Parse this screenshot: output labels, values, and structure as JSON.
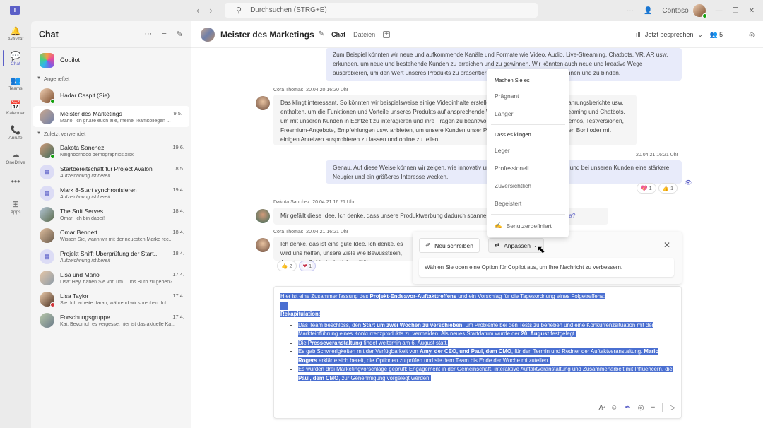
{
  "titlebar": {
    "search_placeholder": "Durchsuchen (STRG+E)",
    "org": "Contoso",
    "icons": [
      "more-icon",
      "people-icon",
      "minimize-icon",
      "restore-icon",
      "close-icon"
    ]
  },
  "rail": [
    {
      "label": "Aktivität",
      "icon": "bell-icon",
      "glyph": "🔔"
    },
    {
      "label": "Chat",
      "icon": "chat-icon",
      "glyph": "💬",
      "active": true
    },
    {
      "label": "Teams",
      "icon": "teams-icon",
      "glyph": "👥"
    },
    {
      "label": "Kalender",
      "icon": "calendar-icon",
      "glyph": "📅"
    },
    {
      "label": "Anrufe",
      "icon": "phone-icon",
      "glyph": "📞"
    },
    {
      "label": "OneDrive",
      "icon": "cloud-icon",
      "glyph": "☁"
    },
    {
      "label": "",
      "icon": "more-icon",
      "glyph": "•••"
    },
    {
      "label": "Apps",
      "icon": "apps-icon",
      "glyph": "⊞"
    }
  ],
  "chatlist": {
    "title": "Chat",
    "copilot": "Copilot",
    "pinned_label": "Angeheftet",
    "recent_label": "Zuletzt verwendet",
    "pinned": [
      {
        "name": "Hadar Caspit (Sie)",
        "preview": "",
        "date": ""
      },
      {
        "name": "Meister des Marketings",
        "preview": "Mario: Ich grüße euch alle, meine Teamkollegen ...",
        "date": "9.5."
      }
    ],
    "recent": [
      {
        "name": "Dakota Sanchez",
        "preview": "Neighborhood demographics.xlsx",
        "date": "19.6.",
        "italic": false
      },
      {
        "name": "Startbereitschaft für Project Avalon",
        "preview": "Aufzeichnung ist bereit",
        "date": "8.5.",
        "italic": true
      },
      {
        "name": "Mark 8-Start synchronisieren",
        "preview": "Aufzeichnung ist bereit",
        "date": "19.4.",
        "italic": true
      },
      {
        "name": "The Soft Serves",
        "preview": "Omar: Ich bin dabei!",
        "date": "18.4.",
        "italic": false
      },
      {
        "name": "Omar Bennett",
        "preview": "Wissen Sie, wann wir mit der neuesten Marke rec...",
        "date": "18.4.",
        "italic": false
      },
      {
        "name": "Projekt Sniff: Überprüfung der Start...",
        "preview": "Aufzeichnung ist bereit",
        "date": "18.4.",
        "italic": true
      },
      {
        "name": "Lisa und Mario",
        "preview": "Lisa: Hey, haben Sie vor, um ... ins Büro zu gehen?",
        "date": "17.4.",
        "italic": false
      },
      {
        "name": "Lisa Taylor",
        "preview": "Sie: Ich arbeite daran, während wir sprechen. Ich...",
        "date": "17.4.",
        "italic": false
      },
      {
        "name": "Forschungsgruppe",
        "preview": "Kai: Bevor ich es vergesse, hier ist das aktuelle Ka...",
        "date": "17.4.",
        "italic": false
      }
    ]
  },
  "header": {
    "title": "Meister des Marketings",
    "tabs": [
      "Chat",
      "Dateien"
    ],
    "meet_now": "Jetzt besprechen",
    "participants": "5"
  },
  "messages": [
    {
      "id": "m1",
      "text": "Zum Beispiel könnten wir neue und aufkommende Kanäle und Formate wie Video, Audio, Live-Streaming, Chatbots, VR, AR usw. erkunden, um neue und bestehende Kunden zu erreichen und zu gewinnen. Wir könnten auch neue und kreative Wege ausprobieren, um den Wert unseres Produkts zu präsentieren und unsere Kunden zu gewinnen und zu binden."
    },
    {
      "id": "m2",
      "author": "Cora Thomas",
      "time": "20.04.20 16:20 Uhr",
      "text": "Das klingt interessant. So könnten wir beispielsweise einige Videoinhalte erstellen, die Tutorials, Interviews, Erfahrungsberichte usw. enthalten, um die Funktionen und Vorteile unseres Produkts auf ansprechende Weise zu präsentieren, Live-Streaming und Chatbots, um mit unseren Kunden in Echtzeit zu interagieren und ihre Fragen zu beantworten. Wir könnten auch einige Demos, Testversionen, Freemium-Angebote, Empfehlungen usw. anbieten, um unsere Kunden unser Produkt kostenlos, mit zusätzlichen Boni oder mit einigen Anreizen ausprobieren zu lassen und online zu teilen."
    },
    {
      "id": "m3",
      "time": "20.04.21 16:21 Uhr",
      "text": "Genau. Auf diese Weise können wir zeigen, wie innovativ und einzigartig unser Produkt ist, und bei unseren Kunden eine stärkere Neugier und ein größeres Interesse wecken.",
      "reactions": [
        {
          "emoji": "💖",
          "count": "1"
        },
        {
          "emoji": "👍",
          "count": "1"
        }
      ]
    },
    {
      "id": "m4",
      "author": "Dakota Sanchez",
      "time": "20.04.21 16:21 Uhr",
      "text": "Mir gefällt diese Idee. Ich denke, dass unsere Produktwerbung dadurch spannender wird. Was meinen Sie, ",
      "mention": "Cora?"
    },
    {
      "id": "m5",
      "author": "Cora Thomas",
      "time": "20.04.21 16:21 Uhr",
      "text": "Ich denke, das ist eine gute Idee. Ich denke, es wird uns helfen, unsere Ziele wie Bewusstsein, Annahme, Zufriedenheit, Loyalität",
      "reactions": [
        {
          "emoji": "👍",
          "count": "2"
        },
        {
          "emoji": "❤",
          "count": "1"
        }
      ]
    }
  ],
  "rewrite_menu": {
    "section1": "Machen Sie es",
    "items1": [
      "Prägnant",
      "Länger"
    ],
    "section2": "Lass es klingen",
    "items2": [
      "Leger",
      "Professionell",
      "Zuversichtlich",
      "Begeistert"
    ],
    "custom": "Benutzerdefiniert"
  },
  "copilot_bar": {
    "rewrite": "Neu schreiben",
    "adjust": "Anpassen",
    "hint": "Wählen Sie oben eine Option für Copilot aus, um Ihre Nachricht zu verbessern."
  },
  "compose": {
    "intro_a": "Hier ist eine Zusammenfassung des ",
    "intro_b": "Projekt-Endeavor-Auftakttreffens",
    "intro_c": " und ein Vorschlag für die Tagesordnung eines Folgetreffens:",
    "recap": "Rekapitulation:",
    "b1a": "Das Team beschloss, den ",
    "b1b": "Start um zwei Wochen zu verschieben",
    "b1c": ", um Probleme bei den Tests zu beheben und eine Konkurrenzsituation mit der Markteinführung eines Konkurrenzprodukts zu vermeiden. Als neues Startdatum wurde der ",
    "b1d": "20. August",
    "b1e": " festgelegt.",
    "b2a": "Die ",
    "b2b": "Presseveranstaltung",
    "b2c": " findet weiterhin am 6. August statt.",
    "b3a": "Es gab Schwierigkeiten mit der Verfügbarkeit von ",
    "b3b": "Amy, der CEO, und Paul, dem CMO",
    "b3c": ", für den Termin und Redner der Auftaktveranstaltung. ",
    "b3d": "Mario Rogers",
    "b3e": " erklärte sich bereit, die Optionen zu prüfen und sie dem Team bis Ende der Woche mitzuteilen.",
    "b4a": "Es wurden drei Marketingvorschläge geprüft: Engagement in der Gemeinschaft, interaktive Auftaktveranstaltung und Zusammenarbeit mit Influencern, die ",
    "b4b": "Paul, dem CMO",
    "b4c": ", zur Genehmigung vorgelegt werden."
  }
}
